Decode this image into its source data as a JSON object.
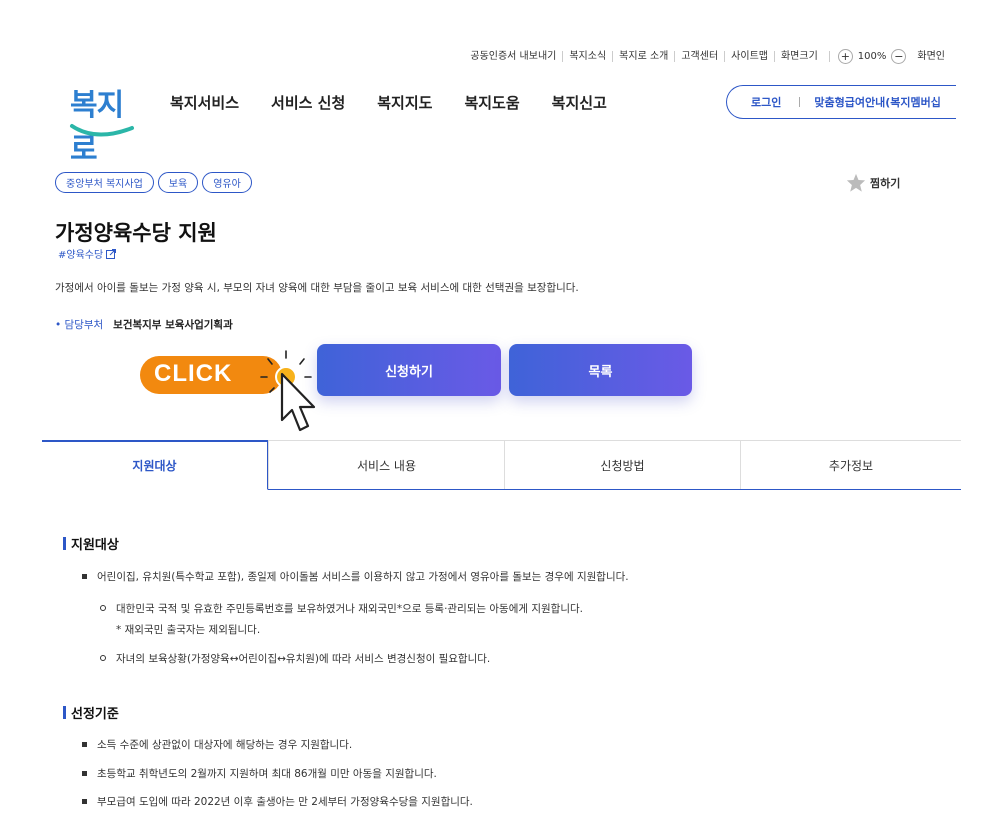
{
  "util": {
    "items": [
      "공동인증서 내보내기",
      "복지소식",
      "복지로 소개",
      "고객센터",
      "사이트맵",
      "화면크기"
    ],
    "zoom_plus": "+",
    "zoom_value": "100%",
    "zoom_minus": "−",
    "screen_label": "화면인"
  },
  "logo": {
    "text": "복지로"
  },
  "gnb": {
    "items": [
      "복지서비스",
      "서비스 신청",
      "복지지도",
      "복지도움",
      "복지신고"
    ]
  },
  "login": {
    "login_label": "로그인",
    "custom_label": "맞춤형급여안내(복지멤버십"
  },
  "tags": [
    "중앙부처 복지사업",
    "보육",
    "영유아"
  ],
  "bookmark": {
    "label": "찜하기"
  },
  "page": {
    "title": "가정양육수당 지원",
    "hashtag": "#양육수당",
    "description": "가정에서 아이를 돌보는 가정 양육 시, 부모의 자녀 양육에 대한 부담을 줄이고 보육 서비스에 대한 선택권을 보장합니다.",
    "dept_label": "• 담당부처",
    "dept_value": "보건복지부 보육사업기획과"
  },
  "click_badge": {
    "text": "CLICK"
  },
  "actions": {
    "apply_label": "신청하기",
    "list_label": "목록"
  },
  "tabs": [
    {
      "label": "지원대상",
      "active": true
    },
    {
      "label": "서비스 내용",
      "active": false
    },
    {
      "label": "신청방법",
      "active": false
    },
    {
      "label": "추가정보",
      "active": false
    }
  ],
  "section1": {
    "title": "지원대상",
    "bullet": "어린이집, 유치원(특수학교 포함), 종일제 아이돌봄 서비스를 이용하지 않고 가정에서 영유아를 돌보는 경우에 지원합니다.",
    "sub1": "대한민국 국적 및 유효한 주민등록번호를 보유하였거나 재외국민*으로 등록·관리되는 아동에게 지원합니다.",
    "note": "* 재외국민 출국자는 제외됩니다.",
    "sub2": "자녀의 보육상황(가정양육↔어린이집↔유치원)에 따라 서비스 변경신청이 필요합니다."
  },
  "section2": {
    "title": "선정기준",
    "bullets": [
      "소득 수준에 상관없이 대상자에 해당하는 경우 지원합니다.",
      "초등학교 취학년도의 2월까지 지원하며 최대 86개월 미만 아동을 지원합니다.",
      "부모급여 도입에 따라 2022년 이후 출생아는 만 2세부터 가정양육수당을 지원합니다."
    ]
  },
  "colors": {
    "primary": "#2d57c7",
    "accent_orange": "#f2890f",
    "button_gradient_start": "#3f63d8",
    "button_gradient_end": "#6a5ae6"
  }
}
